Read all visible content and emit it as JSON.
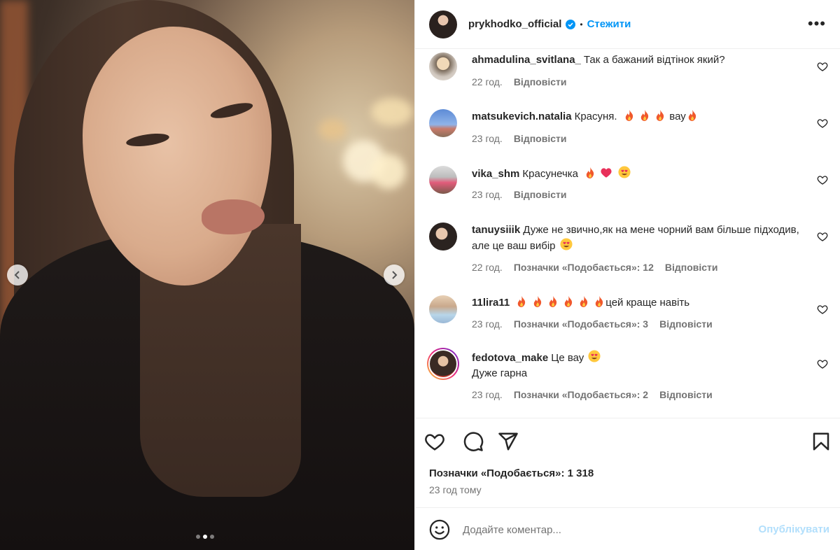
{
  "post": {
    "username": "prykhodko_official",
    "verified": true,
    "follow_label": "Стежити",
    "more_label": "•••",
    "carousel": {
      "slides": 3,
      "active_index": 1
    }
  },
  "comments": [
    {
      "user": "ahmadulina_svitlana_",
      "text": "Так а бажаний відтінок який?",
      "time": "22 год.",
      "likes": "",
      "reply": "Відповісти"
    },
    {
      "user": "matsukevich.natalia",
      "text": "Красуня.",
      "text_after": "вау",
      "time": "23 год.",
      "likes": "",
      "reply": "Відповісти"
    },
    {
      "user": "vika_shm",
      "text": "Красунечка",
      "time": "23 год.",
      "likes": "",
      "reply": "Відповісти"
    },
    {
      "user": "tanuysiiik",
      "text": "Дуже не звично,як на мене чорний вам більше підходив, але це ваш вибір",
      "time": "22 год.",
      "likes": "Позначки «Подобається»: 12",
      "reply": "Відповісти"
    },
    {
      "user": "11lira11",
      "text": "",
      "text_after": "цей краще навіть",
      "time": "23 год.",
      "likes": "Позначки «Подобається»: 3",
      "reply": "Відповісти"
    },
    {
      "user": "fedotova_make",
      "text": "Це вау",
      "text_line2": "Дуже гарна",
      "time": "23 год.",
      "likes": "Позначки «Подобається»: 2",
      "reply": "Відповісти"
    }
  ],
  "summary": {
    "likes": "Позначки «Подобається»: 1 318",
    "time_ago": "23 год тому"
  },
  "composer": {
    "placeholder": "Додайте коментар...",
    "post_label": "Опублікувати"
  },
  "icons": {
    "like": "heart-icon",
    "comment": "comment-icon",
    "share": "paper-plane-icon",
    "save": "bookmark-icon",
    "emoji": "smiley-icon"
  },
  "colors": {
    "accent": "#0095f6",
    "post_disabled": "#b2dffc",
    "muted": "#737373",
    "fire": "#f0582c",
    "heart": "#e8305a"
  }
}
